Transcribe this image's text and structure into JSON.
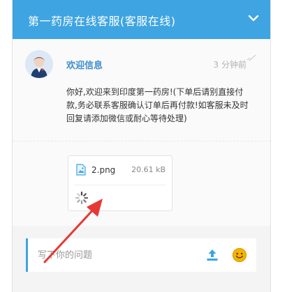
{
  "header": {
    "title": "第一药房在线客服(客服在线)",
    "toggle_icon": "chevron-down-icon"
  },
  "chat": {
    "agent_name": "欢迎信息",
    "time": "3 分钟前",
    "message": "你好,欢迎来到印度第一药房!(下单后请别直接付款,务必联系客服确认订单后再付款!如客服未及时回复请添加微信或耐心等待处理)"
  },
  "attachment": {
    "file_name": "2.png",
    "file_size": "20.61 kB",
    "file_icon": "image-file-icon",
    "status_icon": "loading-spinner-icon"
  },
  "composer": {
    "placeholder": "写下你的问题",
    "upload_icon": "upload-icon",
    "emoji_icon": "emoji-icon"
  },
  "colors": {
    "accent": "#3ea4e2",
    "agent_name": "#3e8ed0",
    "annotation_arrow": "#e53935",
    "emoji": "#f5b400"
  }
}
